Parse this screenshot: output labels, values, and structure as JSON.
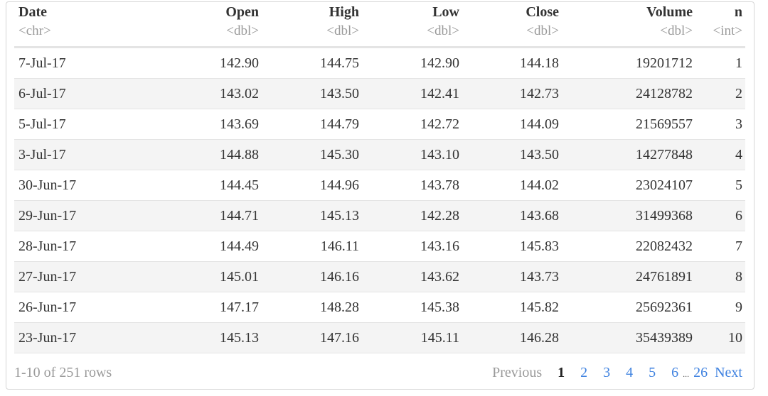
{
  "columns": [
    {
      "name": "Date",
      "type": "<chr>"
    },
    {
      "name": "Open",
      "type": "<dbl>"
    },
    {
      "name": "High",
      "type": "<dbl>"
    },
    {
      "name": "Low",
      "type": "<dbl>"
    },
    {
      "name": "Close",
      "type": "<dbl>"
    },
    {
      "name": "Volume",
      "type": "<dbl>"
    },
    {
      "name": "n",
      "type": "<int>"
    }
  ],
  "rows": [
    [
      "7-Jul-17",
      "142.90",
      "144.75",
      "142.90",
      "144.18",
      "19201712",
      "1"
    ],
    [
      "6-Jul-17",
      "143.02",
      "143.50",
      "142.41",
      "142.73",
      "24128782",
      "2"
    ],
    [
      "5-Jul-17",
      "143.69",
      "144.79",
      "142.72",
      "144.09",
      "21569557",
      "3"
    ],
    [
      "3-Jul-17",
      "144.88",
      "145.30",
      "143.10",
      "143.50",
      "14277848",
      "4"
    ],
    [
      "30-Jun-17",
      "144.45",
      "144.96",
      "143.78",
      "144.02",
      "23024107",
      "5"
    ],
    [
      "29-Jun-17",
      "144.71",
      "145.13",
      "142.28",
      "143.68",
      "31499368",
      "6"
    ],
    [
      "28-Jun-17",
      "144.49",
      "146.11",
      "143.16",
      "145.83",
      "22082432",
      "7"
    ],
    [
      "27-Jun-17",
      "145.01",
      "146.16",
      "143.62",
      "143.73",
      "24761891",
      "8"
    ],
    [
      "26-Jun-17",
      "147.17",
      "148.28",
      "145.38",
      "145.82",
      "25692361",
      "9"
    ],
    [
      "23-Jun-17",
      "145.13",
      "147.16",
      "145.11",
      "146.28",
      "35439389",
      "10"
    ]
  ],
  "footer": {
    "row_info": "1-10 of 251 rows",
    "previous": "Previous",
    "pages": [
      "1",
      "2",
      "3",
      "4",
      "5",
      "6"
    ],
    "ellipsis": "...",
    "last_page": "26",
    "next": "Next",
    "current_page": "1"
  },
  "colors": {
    "link": "#3f82e0",
    "muted": "#9a9a9a",
    "stripe": "#f4f4f4"
  }
}
